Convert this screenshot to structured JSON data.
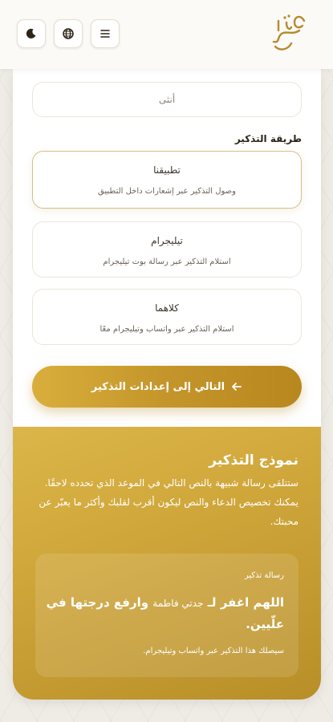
{
  "header": {
    "logo_text": "رحمة اللهم",
    "menu_icon": "menu-icon",
    "language_icon": "globe-icon",
    "theme_icon": "moon-icon"
  },
  "form": {
    "gender_value": "أنثى",
    "reminder_method_label": "طريقة التذكير",
    "options": [
      {
        "title": "تطبيقنا",
        "description": "وصول التذكير عبر إشعارات داخل التطبيق",
        "selected": true
      },
      {
        "title": "تيليجرام",
        "description": "استلام التذكير عبر رسالة بوت تيليجرام",
        "selected": false
      },
      {
        "title": "كلاهما",
        "description": "استلام التذكير عبر واتساب وتيليجرام معًا",
        "selected": false
      }
    ],
    "next_button_label": "التالي إلى إعدادات التذكير"
  },
  "sample": {
    "title": "نموذج التذكير",
    "body": "ستتلقى رسالة شبيهة بالنص التالي في الموعد الذي تحدده لاحقًا. يمكنك تخصيص الدعاء والنص ليكون أقرب لقلبك وأكثر ما يعبّر عن محبتك.",
    "message_label": "رسالة تذكير",
    "message_part1": "اللهم اغفر لـ",
    "message_name": "جدتي فاطمة",
    "message_part2": "وارفع درجتها في علّيين.",
    "message_note": "سيصلك هذا التذكير عبر واتساب وتيليجرام."
  },
  "colors": {
    "accent_gold": "#c9a13a",
    "selected_border": "#d6bf87"
  }
}
